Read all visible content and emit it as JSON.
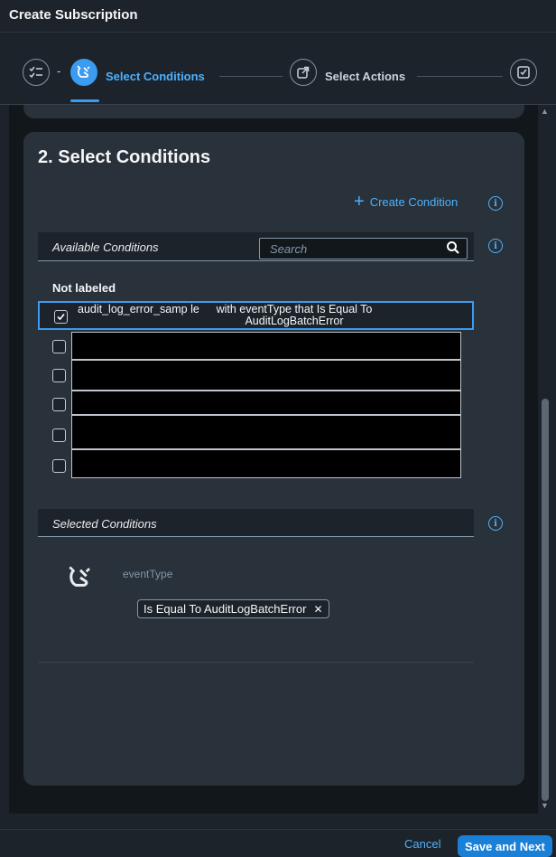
{
  "dialog": {
    "title": "Create Subscription"
  },
  "wizard": {
    "steps": [
      {
        "name": "checklist-icon",
        "label": ""
      },
      {
        "name": "conditions-icon",
        "label": "Select Conditions"
      },
      {
        "name": "share-icon",
        "label": "Select Actions"
      },
      {
        "name": "checkbox-icon",
        "label": ""
      }
    ],
    "separator": "-"
  },
  "section": {
    "title": "2. Select Conditions",
    "create_condition": "Create Condition"
  },
  "available": {
    "header": "Available Conditions",
    "search_placeholder": "Search",
    "group_label": "Not labeled",
    "selected_row": {
      "name": "audit_log_error_samp le",
      "description": "with eventType that Is Equal To AuditLogBatchError",
      "checked": true
    },
    "redacted_rows": 5
  },
  "selected": {
    "header": "Selected Conditions",
    "event_label": "eventType",
    "token": "Is Equal To AuditLogBatchError",
    "token_remove": "✕"
  },
  "footer": {
    "cancel": "Cancel",
    "save_next": "Save and Next"
  },
  "colors": {
    "accent": "#3a9bf0",
    "background": "#1d232a",
    "card": "#29313a"
  }
}
